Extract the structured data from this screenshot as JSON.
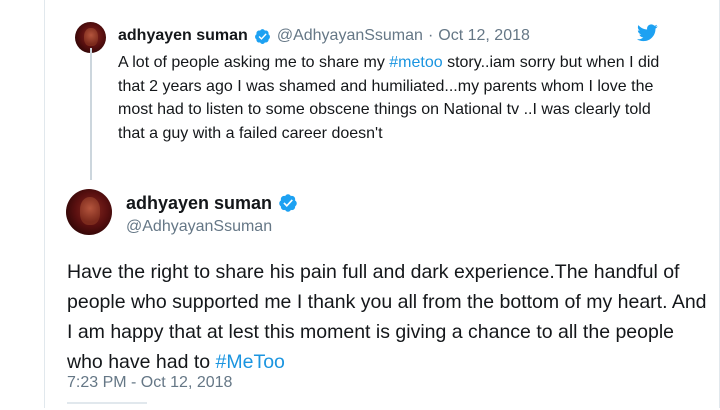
{
  "quoted_tweet": {
    "name": "adhyayen suman",
    "handle": "@AdhyayanSsuman",
    "separator": "·",
    "date": "Oct 12, 2018",
    "text_before_hashtag": "A lot of people asking me to share my ",
    "hashtag": "#metoo",
    "text_after_hashtag": " story..iam sorry but when I did that 2 years ago I was shamed and humiliated...my parents whom I love the most had to listen to some obscene things on National tv ..I was clearly told that a guy with a failed career doesn't"
  },
  "main_tweet": {
    "name": "adhyayen suman",
    "handle": "@AdhyayanSsuman",
    "text_before_hashtag": "Have the right to share his pain full and dark experience.The handful of people who supported me I thank you all from the bottom of my heart. And I am happy that at lest this moment is giving a chance to all the people who have had to ",
    "hashtag": "#MeToo",
    "timestamp": "7:23 PM - Oct 12, 2018"
  },
  "icons": {
    "verified": "verified-badge-icon",
    "twitter": "twitter-bird-icon",
    "avatar": "profile-photo"
  },
  "colors": {
    "accent": "#1b95e0",
    "verified": "#1da1f2",
    "text": "#14171a",
    "muted": "#657786",
    "avatar_dark_red": "#5a1010"
  }
}
